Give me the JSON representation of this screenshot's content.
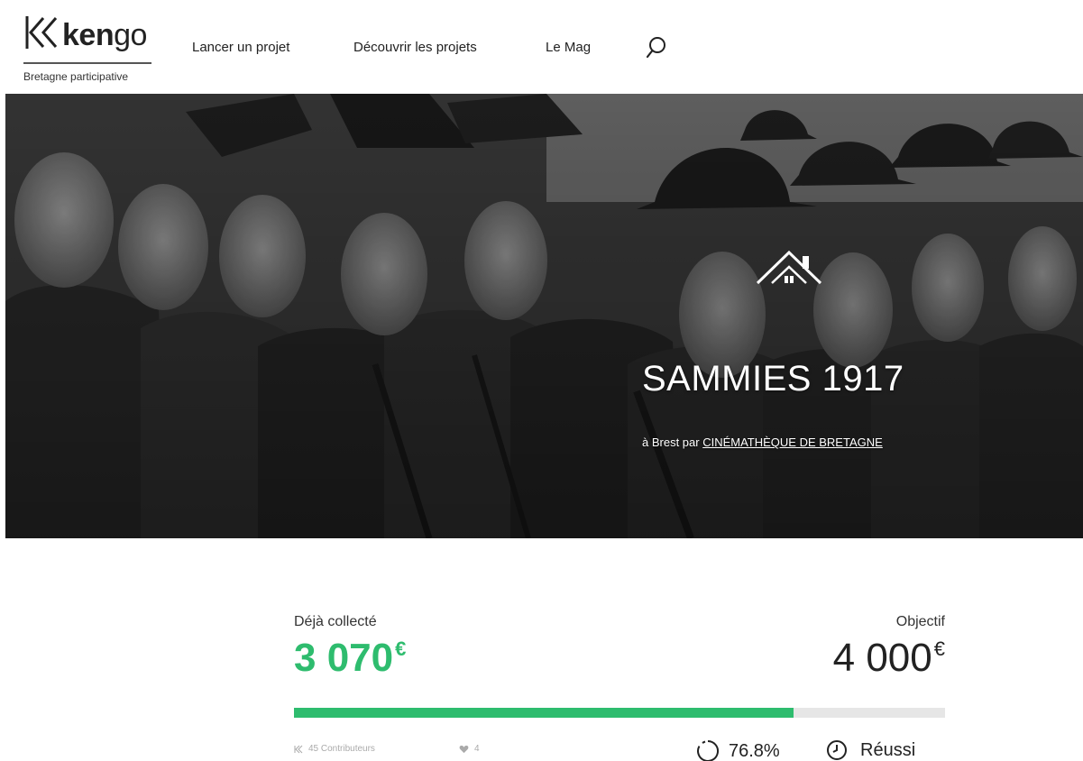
{
  "brand": {
    "name_bold": "ken",
    "name_light": "go",
    "subtitle": "Bretagne participative"
  },
  "nav": {
    "items": [
      "Lancer un projet",
      "Découvrir les projets",
      "Le Mag"
    ],
    "search_icon": "search-icon"
  },
  "project": {
    "category_icon": "home-icon",
    "title": "SAMMIES 1917",
    "location_prefix": "à Brest par ",
    "owner": "CINÉMATHÈQUE DE BRETAGNE"
  },
  "funding": {
    "collected_label": "Déjà collecté",
    "collected_amount": "3 070",
    "target_label": "Objectif",
    "target_amount": "4 000",
    "currency": "€",
    "progress_fraction": 0.768,
    "contributors": "45 Contributeurs",
    "likes": "4",
    "percent": "76.8%",
    "status": "Réussi"
  },
  "colors": {
    "accent_green": "#2ebc6e",
    "track_grey": "#e6e6e6"
  }
}
